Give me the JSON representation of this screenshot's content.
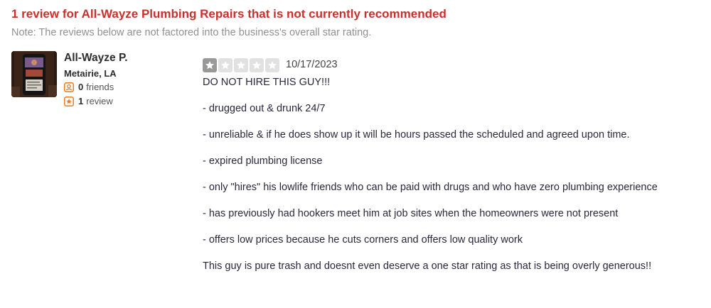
{
  "header": {
    "title": "1 review for All-Wayze Plumbing Repairs that is not currently recommended",
    "note": "Note: The reviews below are not factored into the business's overall star rating."
  },
  "user": {
    "name": "All-Wayze P.",
    "location": "Metairie, LA",
    "friends_count": "0",
    "friends_label": "friends",
    "reviews_count": "1",
    "reviews_label": "review",
    "icons": {
      "friends": "friends-icon",
      "reviews": "star-icon"
    }
  },
  "review": {
    "rating": 1,
    "rating_max": 5,
    "date": "10/17/2023",
    "lines": [
      "DO NOT HIRE THIS GUY!!!",
      "- drugged out & drunk 24/7",
      "- unreliable & if he does show up it will be hours passed the scheduled and agreed upon time.",
      "- expired plumbing license",
      "- only \"hires\" his lowlife friends who can be paid with drugs and who have zero plumbing experience",
      "- has previously had hookers meet him at job sites when the homeowners were not present",
      "- offers low prices because he cuts corners and offers low quality work",
      "This guy is pure trash and doesnt even deserve a one star rating as that is being overly generous!!"
    ]
  },
  "colors": {
    "title_red": "#c9302c",
    "note_gray": "#909090",
    "star_filled": "#999999",
    "star_empty": "#e1e1e1",
    "icon_orange": "#f07a1a"
  }
}
